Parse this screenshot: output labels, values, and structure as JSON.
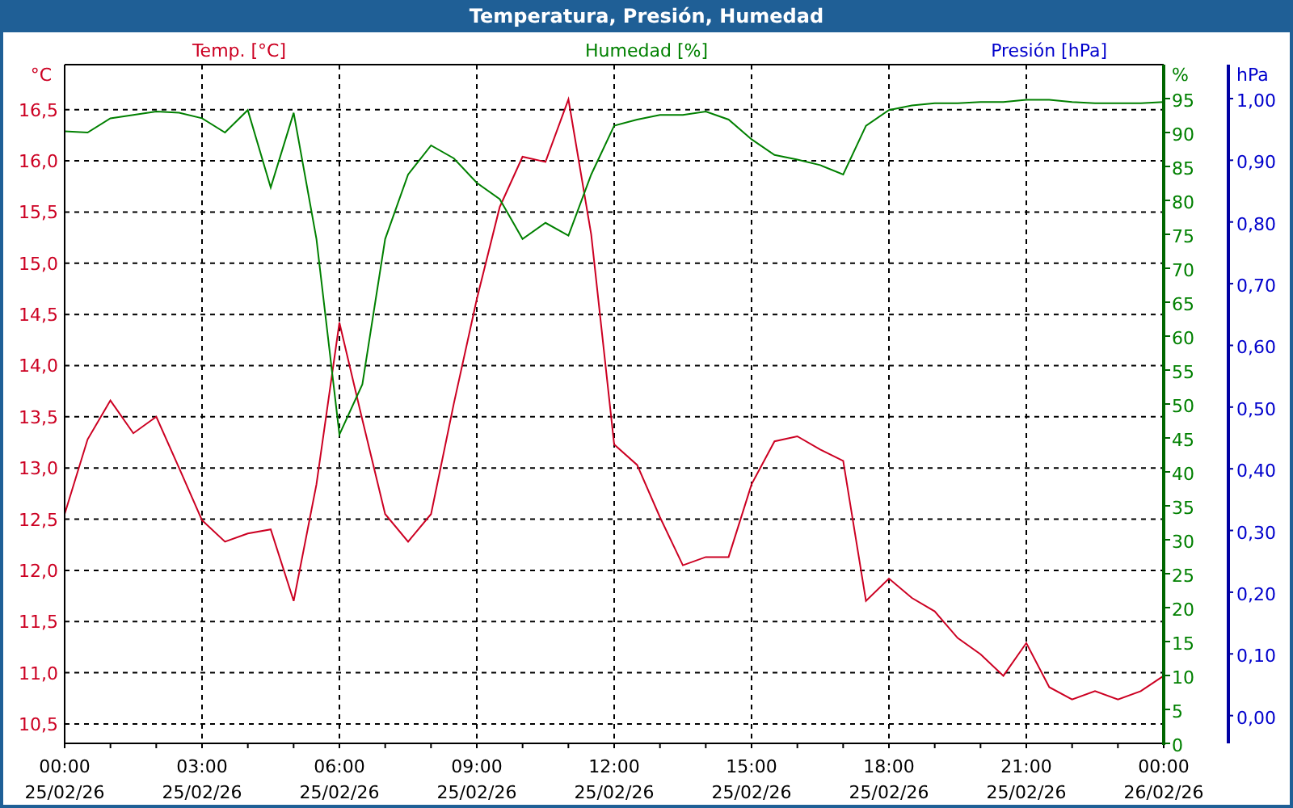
{
  "window": {
    "title": "Temperatura, Presión, Humedad"
  },
  "chart": {
    "chart_data": {
      "type": "line",
      "grid": true,
      "categories": [
        "00:00 25/02/26",
        null,
        null,
        null,
        null,
        null,
        "03:00 25/02/26",
        null,
        null,
        null,
        null,
        null,
        "06:00 25/02/26",
        null,
        null,
        null,
        null,
        null,
        "09:00 25/02/26",
        null,
        null,
        null,
        null,
        null,
        "12:00 25/02/26",
        null,
        null,
        null,
        null,
        null,
        "15:00 25/02/26",
        null,
        null,
        null,
        null,
        null,
        "18:00 25/02/26",
        null,
        null,
        null,
        null,
        null,
        "21:00 25/02/26",
        null,
        null,
        null,
        null,
        null,
        "00:00 26/02/26"
      ],
      "ylabel": "°C",
      "ylim": [
        10.31,
        16.94
      ],
      "yticks": [
        {
          "value": 10.5,
          "label": "10,5"
        },
        {
          "value": 11,
          "label": "11,0"
        },
        {
          "value": 11.5,
          "label": "11,5"
        },
        {
          "value": 12,
          "label": "12,0"
        },
        {
          "value": 12.5,
          "label": "12,5"
        },
        {
          "value": 13,
          "label": "13,0"
        },
        {
          "value": 13.5,
          "label": "13,5"
        },
        {
          "value": 14,
          "label": "14,0"
        },
        {
          "value": 14.5,
          "label": "14,5"
        },
        {
          "value": 15,
          "label": "15,0"
        },
        {
          "value": 15.5,
          "label": "15,5"
        },
        {
          "value": 16,
          "label": "16,0"
        },
        {
          "value": 16.5,
          "label": "16,5"
        }
      ],
      "y2label": "%",
      "y2lim": [
        0,
        100
      ],
      "y2ticks": [
        0,
        5,
        10,
        15,
        20,
        25,
        30,
        35,
        40,
        45,
        50,
        55,
        60,
        65,
        70,
        75,
        80,
        85,
        90,
        95
      ],
      "y3label": "hPa",
      "y3lim": [
        -0.045,
        1.055
      ],
      "y3ticks": [
        {
          "value": 0,
          "label": "0,00"
        },
        {
          "value": 0.1,
          "label": "0,10"
        },
        {
          "value": 0.2,
          "label": "0,20"
        },
        {
          "value": 0.3,
          "label": "0,30"
        },
        {
          "value": 0.4,
          "label": "0,40"
        },
        {
          "value": 0.5,
          "label": "0,50"
        },
        {
          "value": 0.6,
          "label": "0,60"
        },
        {
          "value": 0.7,
          "label": "0,70"
        },
        {
          "value": 0.8,
          "label": "0,80"
        },
        {
          "value": 0.9,
          "label": "0,90"
        },
        {
          "value": 1,
          "label": "1,00"
        }
      ],
      "series": [
        {
          "name": "Temp. [°C]",
          "color": "#cc0022",
          "values": [
            12.55,
            13.28,
            13.66,
            13.34,
            13.5,
            13.0,
            12.49,
            12.28,
            12.36,
            12.4,
            11.7,
            12.84,
            14.42,
            13.47,
            12.55,
            12.28,
            12.55,
            13.63,
            14.65,
            15.55,
            16.04,
            15.99,
            16.6,
            15.28,
            13.23,
            13.03,
            12.52,
            12.05,
            12.13,
            12.13,
            12.84,
            13.26,
            13.31,
            13.18,
            13.07,
            11.7,
            11.92,
            11.73,
            11.6,
            11.34,
            11.18,
            10.97,
            11.29,
            10.86,
            10.74,
            10.82,
            10.74,
            10.82,
            10.97
          ]
        },
        {
          "name": "Humedad [%]",
          "color": "#008000",
          "axis": "y2",
          "values": [
            90.2,
            90,
            92.1,
            92.6,
            93.1,
            92.9,
            92.1,
            90,
            93.3,
            81.9,
            92.9,
            74.3,
            45.5,
            52.9,
            74.3,
            83.8,
            88.1,
            86.2,
            82.6,
            80.2,
            74.3,
            76.7,
            74.8,
            83.8,
            91,
            91.9,
            92.6,
            92.6,
            93.1,
            91.9,
            89,
            86.7,
            86,
            85.2,
            83.8,
            91,
            93.3,
            94,
            94.3,
            94.3,
            94.5,
            94.5,
            94.8,
            94.8,
            94.5,
            94.3,
            94.3,
            94.3,
            94.5
          ]
        },
        {
          "name": "Presión [hPa]",
          "color": "#0000cc",
          "axis": "y3",
          "values": [
            null,
            null,
            null,
            null,
            null,
            null,
            null,
            null,
            null,
            null,
            null,
            null,
            null,
            null,
            null,
            null,
            null,
            null,
            null,
            null,
            null,
            null,
            null,
            null,
            null,
            null,
            null,
            null,
            null,
            null,
            null,
            null,
            null,
            null,
            null,
            null,
            null,
            null,
            null,
            null,
            null,
            null,
            null,
            null,
            null,
            null,
            null,
            null,
            null
          ]
        }
      ]
    }
  }
}
